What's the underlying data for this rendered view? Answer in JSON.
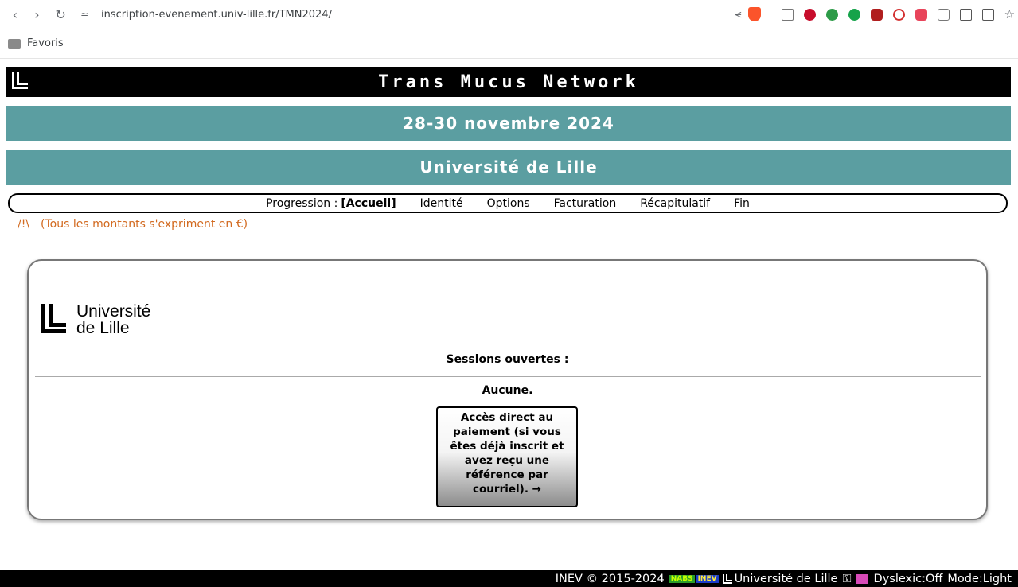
{
  "browser": {
    "url": "inscription-evenement.univ-lille.fr/TMN2024/",
    "bookmarks_folder": "Favoris"
  },
  "header": {
    "title": "Trans Mucus Network",
    "dates": "28-30 novembre 2024",
    "venue": "Université de Lille"
  },
  "progress": {
    "label": "Progression :",
    "steps": [
      "[Accueil]",
      "Identité",
      "Options",
      "Facturation",
      "Récapitulatif",
      "Fin"
    ],
    "current_index": 0
  },
  "notice": {
    "icon": "/!\\",
    "text": "(Tous les montants s'expriment en €)"
  },
  "card": {
    "logo_line1": "Université",
    "logo_line2": "de Lille",
    "sessions_title": "Sessions ouvertes :",
    "sessions_empty": "Aucune.",
    "direct_payment_button": "Accès direct au paiement (si vous êtes déjà inscrit et avez reçu une référence par courriel). →"
  },
  "footer": {
    "copyright": "INEV © 2015-2024",
    "nabs_badge": "NABS",
    "inev_badge": "INEV",
    "university": "Université de Lille",
    "dyslexic": "Dyslexic:Off",
    "mode": "Mode:Light"
  },
  "colors": {
    "title_bar": "#000000",
    "band": "#5b9ea1",
    "notice": "#d2691e"
  }
}
